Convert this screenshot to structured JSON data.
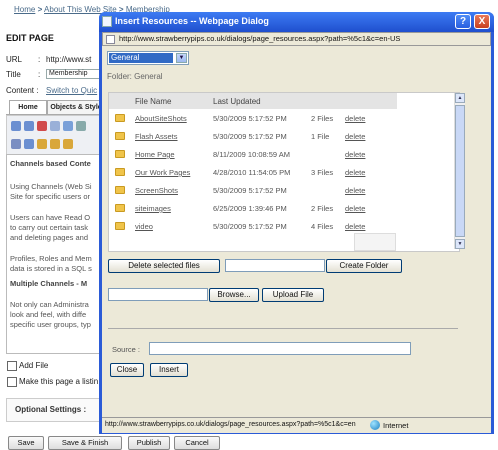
{
  "background_page": {
    "breadcrumb": [
      "Home",
      ">",
      "About This Web Site",
      ">",
      "Membership"
    ],
    "title": "EDIT PAGE",
    "url_label": "URL",
    "url_value": "http://www.st",
    "title_label": "Title",
    "title_value": "Membership",
    "content_label": "Content :",
    "content_link": "Switch to Quic",
    "tabs": [
      "Home",
      "Objects & Style"
    ],
    "editor_lines": [
      {
        "text": "Channels based Conte",
        "heading": true
      },
      {
        "text": "Using Channels (Web Si",
        "heading": false
      },
      {
        "text": "Site for specific users or",
        "heading": false
      },
      {
        "text": "Users can have Read O",
        "heading": false
      },
      {
        "text": "to carry out certain task",
        "heading": false
      },
      {
        "text": "and deleting pages and",
        "heading": false
      },
      {
        "text": "Profiles, Roles and Mem",
        "heading": false
      },
      {
        "text": "data is stored in a SQL s",
        "heading": false
      },
      {
        "text": "Multiple Channels - M",
        "heading": true
      },
      {
        "text": "Not only can Administra",
        "heading": false
      },
      {
        "text": "look and feel, with diffe",
        "heading": false
      },
      {
        "text": "specific user groups, typ",
        "heading": false
      }
    ],
    "add_file_label": "Add File",
    "listing_label": "Make this page a listin",
    "optional_settings": "Optional Settings :",
    "bottom_buttons": [
      "Save",
      "Save & Finish",
      "Publish",
      "Cancel"
    ]
  },
  "dialog": {
    "title": "Insert Resources -- Webpage Dialog",
    "address": "http://www.strawberrypips.co.uk/dialogs/page_resources.aspx?path=%5c1&c=en-US",
    "window_buttons": {
      "help": "?",
      "close": "X"
    },
    "folder_select": {
      "selected": "General"
    },
    "folder_label": "Folder: General",
    "list_headers": {
      "name": "File Name",
      "updated": "Last Updated"
    },
    "rows": [
      {
        "name": "AboutSiteShots",
        "date": "5/30/2009 5:17:52 PM",
        "files": "2 Files",
        "action": "delete"
      },
      {
        "name": "Flash Assets",
        "date": "5/30/2009 5:17:52 PM",
        "files": "1 File",
        "action": "delete"
      },
      {
        "name": "Home Page",
        "date": "8/11/2009 10:08:59 AM",
        "files": "",
        "action": "delete"
      },
      {
        "name": "Our Work Pages",
        "date": "4/28/2010 11:54:05 PM",
        "files": "3 Files",
        "action": "delete"
      },
      {
        "name": "ScreenShots",
        "date": "5/30/2009 5:17:52 PM",
        "files": "",
        "action": "delete"
      },
      {
        "name": "siteimages",
        "date": "6/25/2009 1:39:46 PM",
        "files": "2 Files",
        "action": "delete"
      },
      {
        "name": "video",
        "date": "5/30/2009 5:17:52 PM",
        "files": "4 Files",
        "action": "delete"
      }
    ],
    "delete_selected_label": "Delete selected files",
    "create_folder_label": "Create Folder",
    "browse_label": "Browse...",
    "upload_label": "Upload File",
    "source_label": "Source :",
    "close_label": "Close",
    "insert_label": "Insert",
    "status_url": "http://www.strawberrypips.co.uk/dialogs/page_resources.aspx?path=%5c1&c=en",
    "status_zone": "Internet"
  },
  "colors": {
    "titlebar": "#2b5bd7",
    "dialog_face": "#ece9d8",
    "selection": "#316ac5",
    "folder": "#f0c44a",
    "link": "#4a6b8a"
  }
}
